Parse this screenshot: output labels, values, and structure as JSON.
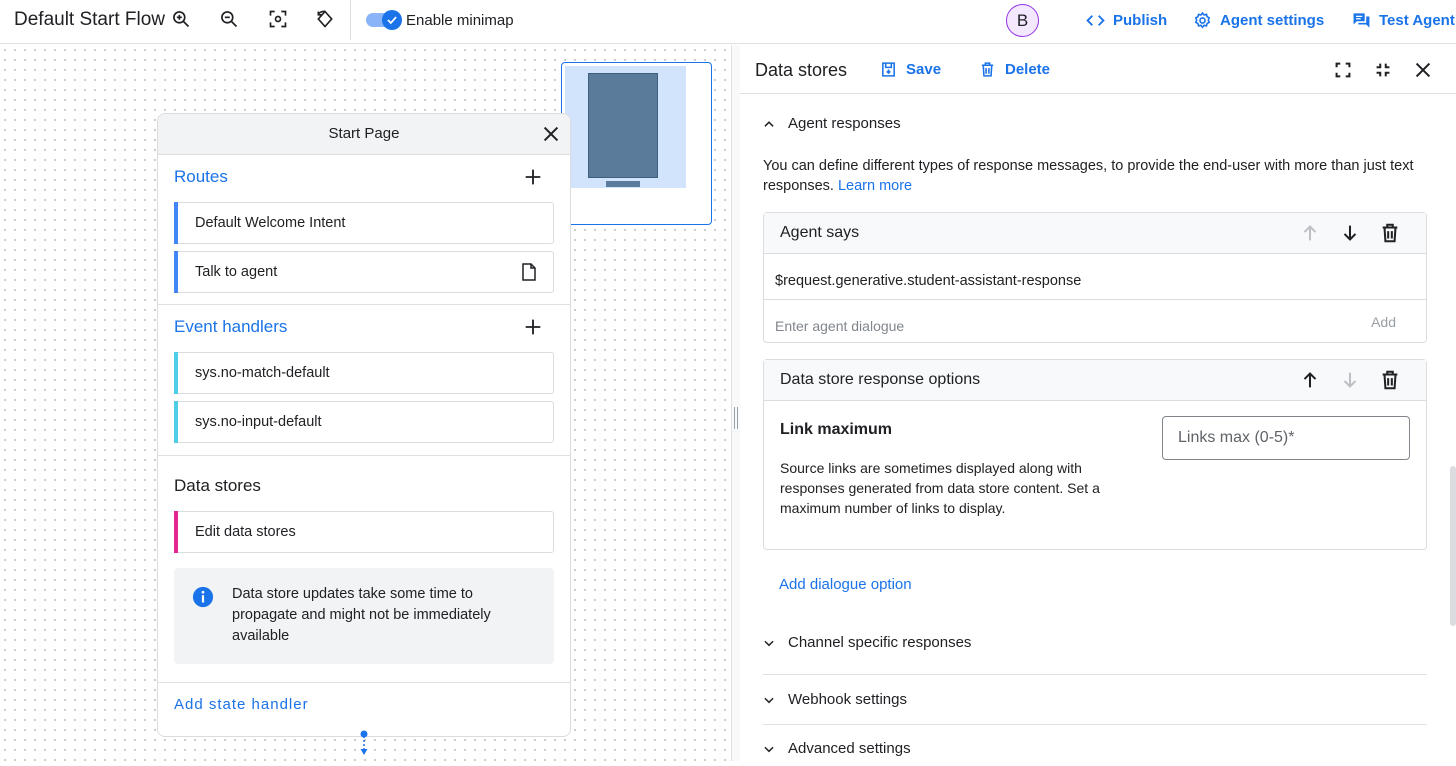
{
  "header": {
    "flow_title": "Default Start Flow",
    "minimap_toggle_label": "Enable minimap",
    "minimap_enabled": true,
    "avatar_initial": "B",
    "publish_label": "Publish",
    "agent_settings_label": "Agent settings",
    "test_agent_label": "Test Agent"
  },
  "page_card": {
    "title": "Start Page",
    "routes_title": "Routes",
    "routes": [
      {
        "label": "Default Welcome Intent"
      },
      {
        "label": "Talk to agent"
      }
    ],
    "event_handlers_title": "Event handlers",
    "event_handlers": [
      {
        "label": "sys.no-match-default"
      },
      {
        "label": "sys.no-input-default"
      }
    ],
    "data_stores_title": "Data stores",
    "data_stores_item": "Edit data stores",
    "info_text": "Data store updates take some time to propagate and might not be immediately available",
    "add_state_handler": "Add state handler"
  },
  "panel": {
    "title": "Data stores",
    "save_label": "Save",
    "delete_label": "Delete",
    "agent_responses_title": "Agent responses",
    "description": "You can define different types of response messages, to provide the end-user with more than just text responses.",
    "learn_more": "Learn more",
    "agent_says": {
      "title": "Agent says",
      "value": "$request.generative.student-assistant-response",
      "placeholder": "Enter agent dialogue",
      "add_label": "Add"
    },
    "data_store_options": {
      "title": "Data store response options",
      "link_maximum_title": "Link maximum",
      "link_maximum_desc": "Source links are sometimes displayed along with responses generated from data store content. Set a maximum number of links to display.",
      "links_max_placeholder": "Links max (0-5)*"
    },
    "add_dialogue_option": "Add dialogue option",
    "sections": [
      {
        "label": "Channel specific responses"
      },
      {
        "label": "Webhook settings"
      },
      {
        "label": "Advanced settings"
      }
    ]
  },
  "colors": {
    "accent": "#1a73e8",
    "route_bar": "#4285f4",
    "event_bar": "#4ecde6",
    "data_store_bar": "#e52592",
    "avatar_border": "#9334e6"
  }
}
